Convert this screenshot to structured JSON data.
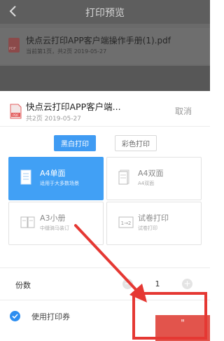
{
  "nav": {
    "title": "打印预览",
    "back_icon": "chevron-left-icon"
  },
  "background_file": {
    "name": "快点云打印APP客户端操作手册(1).pdf",
    "meta": "当前第1页，共2页 2019-05-27"
  },
  "sheet": {
    "file_title": "快点云打印APP客户端...",
    "file_meta": "共2页 2019-05-27",
    "cancel": "取消",
    "color_modes": [
      {
        "label": "黑白打印",
        "selected": true
      },
      {
        "label": "彩色打印",
        "selected": false
      }
    ],
    "layouts": [
      {
        "title": "A4单面",
        "subtitle": "适用于大多数场景",
        "icon": "a4-single-sided-icon",
        "selected": true
      },
      {
        "title": "A4双面",
        "subtitle": "A4双面",
        "icon": "a4-double-sided-icon",
        "selected": false
      },
      {
        "title": "A3小册",
        "subtitle": "中缝骑马装订",
        "icon": "a3-booklet-icon",
        "selected": false
      },
      {
        "title": "试卷打印",
        "subtitle": "试卷打印",
        "icon": "exam-paper-icon",
        "selected": false
      }
    ],
    "copies": {
      "label": "份数",
      "value": "1",
      "minus": "−",
      "plus": "+"
    },
    "coupon": {
      "label": "使用打印券",
      "checked": true
    },
    "submit_partial": "\""
  },
  "colors": {
    "accent_blue": "#41a0f5",
    "annotation_red": "#e53833",
    "submit_red": "#e2544c"
  }
}
